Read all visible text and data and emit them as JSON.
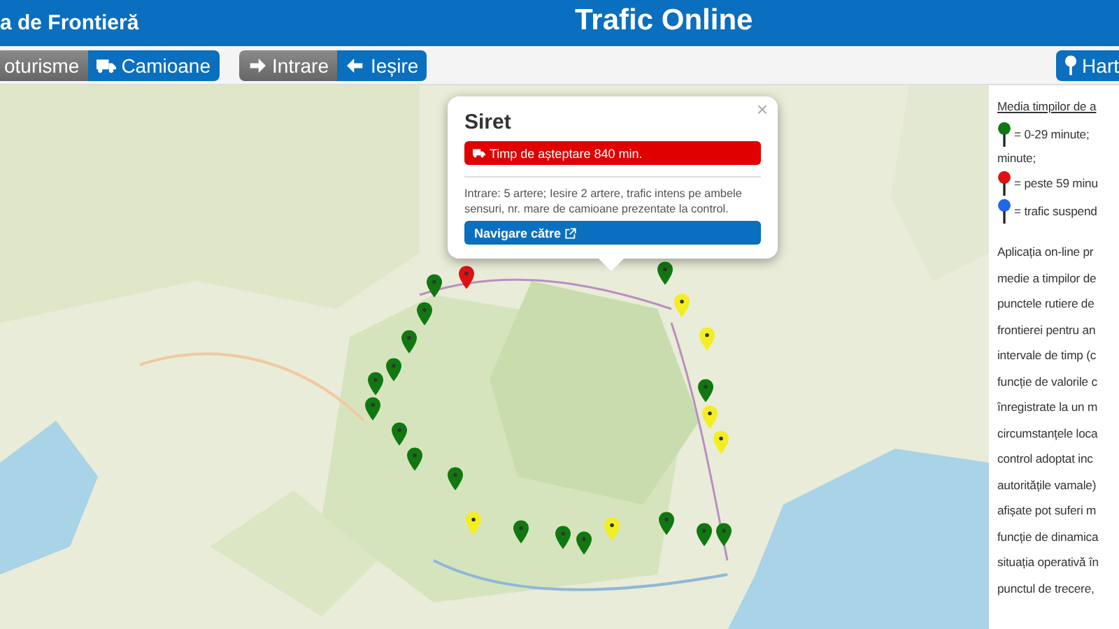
{
  "header": {
    "site_title": "a de Frontieră",
    "page_title": "Trafic Online"
  },
  "toolbar": {
    "vehicle_buttons": [
      {
        "label": "oturisme",
        "selected": false
      },
      {
        "label": "Camioane",
        "selected": true
      }
    ],
    "direction_buttons": [
      {
        "label": "Intrare",
        "selected": false
      },
      {
        "label": "Ieșire",
        "selected": true
      }
    ],
    "map_button": {
      "label": "Hart"
    }
  },
  "markers": [
    {
      "color": "#dd1111"
    },
    {
      "color": "#117711"
    },
    {
      "color": "#117711"
    },
    {
      "color": "#117711"
    },
    {
      "color": "#117711"
    },
    {
      "color": "#117711"
    },
    {
      "color": "#117711"
    },
    {
      "color": "#117711"
    },
    {
      "color": "#117711"
    },
    {
      "color": "#117711"
    },
    {
      "color": "#117711"
    },
    {
      "color": "#117711"
    },
    {
      "color": "#117711"
    },
    {
      "color": "#117711"
    },
    {
      "color": "#117711"
    },
    {
      "color": "#117711"
    },
    {
      "color": "#117711"
    },
    {
      "color": "#117711"
    },
    {
      "color": "#f2ee22"
    },
    {
      "color": "#f2ee22"
    },
    {
      "color": "#f2ee22"
    },
    {
      "color": "#f2ee22"
    },
    {
      "color": "#f2ee22"
    },
    {
      "color": "#f2ee22"
    }
  ],
  "popup": {
    "title": "Siret",
    "wait": "Timp de așteptare 840 min.",
    "details": "Intrare: 5 artere; Iesire 2 artere, trafic intens pe ambele sensuri, nr. mare de camioane prezentate la control.",
    "navigate": "Navigare către",
    "close": "×"
  },
  "legend": {
    "title": "Media timpilor de a",
    "items": [
      {
        "color": "#117711",
        "text": "= 0-29 minute;"
      },
      {
        "color": "#dd1111",
        "text": "= peste 59 minu"
      },
      {
        "color": "#2266ee",
        "text": "= trafic suspend"
      }
    ],
    "wrap": "minute;"
  },
  "info_lines": [
    "Aplicația on-line pr",
    "medie a timpilor de",
    "punctele rutiere de",
    "frontierei pentru an",
    "intervale de timp (c",
    "funcție de valorile c",
    "înregistrate la un m",
    "circumstanțele loca",
    "control adoptat inc",
    "autoritățile vamale)",
    "afișate pot suferi m",
    "funcție de dinamica",
    "situația operativă în",
    "punctul de trecere,"
  ]
}
